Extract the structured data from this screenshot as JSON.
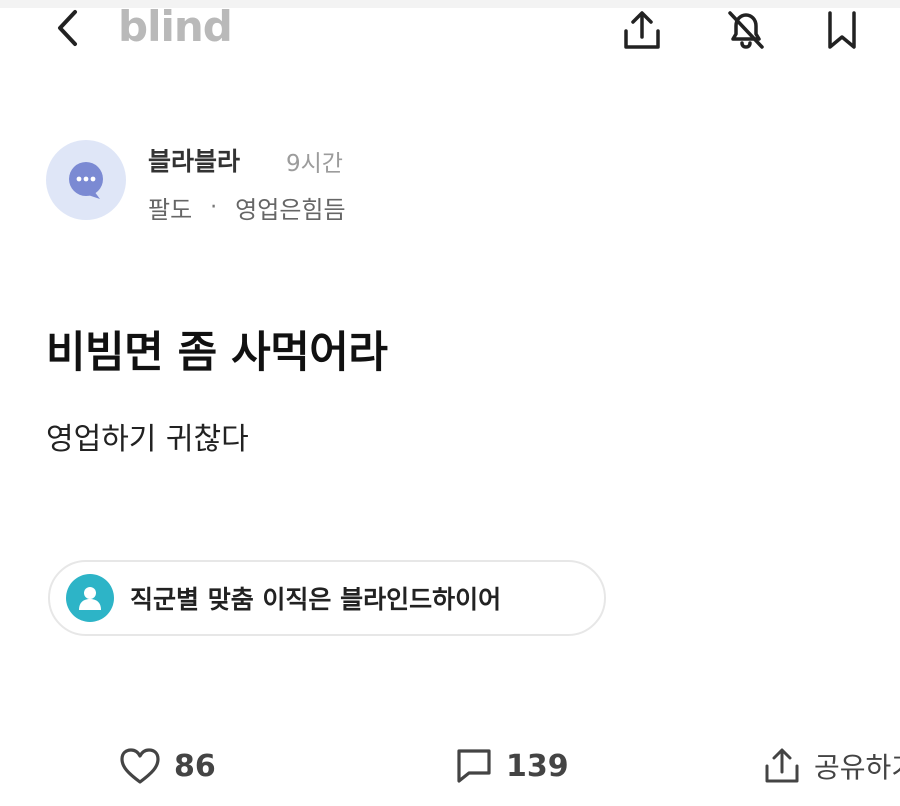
{
  "header": {
    "logo": "blind",
    "icons": {
      "back": "chevron-left-icon",
      "share": "share-upload-icon",
      "notification": "bell-off-icon",
      "bookmark": "bookmark-icon"
    }
  },
  "post": {
    "author": {
      "name": "블라블라",
      "time": "9시간",
      "company": "팔도",
      "separator": "·",
      "board": "영업은힘듬"
    },
    "title": "비빔면 좀 사먹어라",
    "body": "영업하기 귀찮다"
  },
  "promo": {
    "text": "직군별 맞춤 이직은 블라인드하이어",
    "icon_color": "#2db4c7"
  },
  "actions": {
    "likes": "86",
    "comments": "139",
    "share_label": "공유하기"
  }
}
